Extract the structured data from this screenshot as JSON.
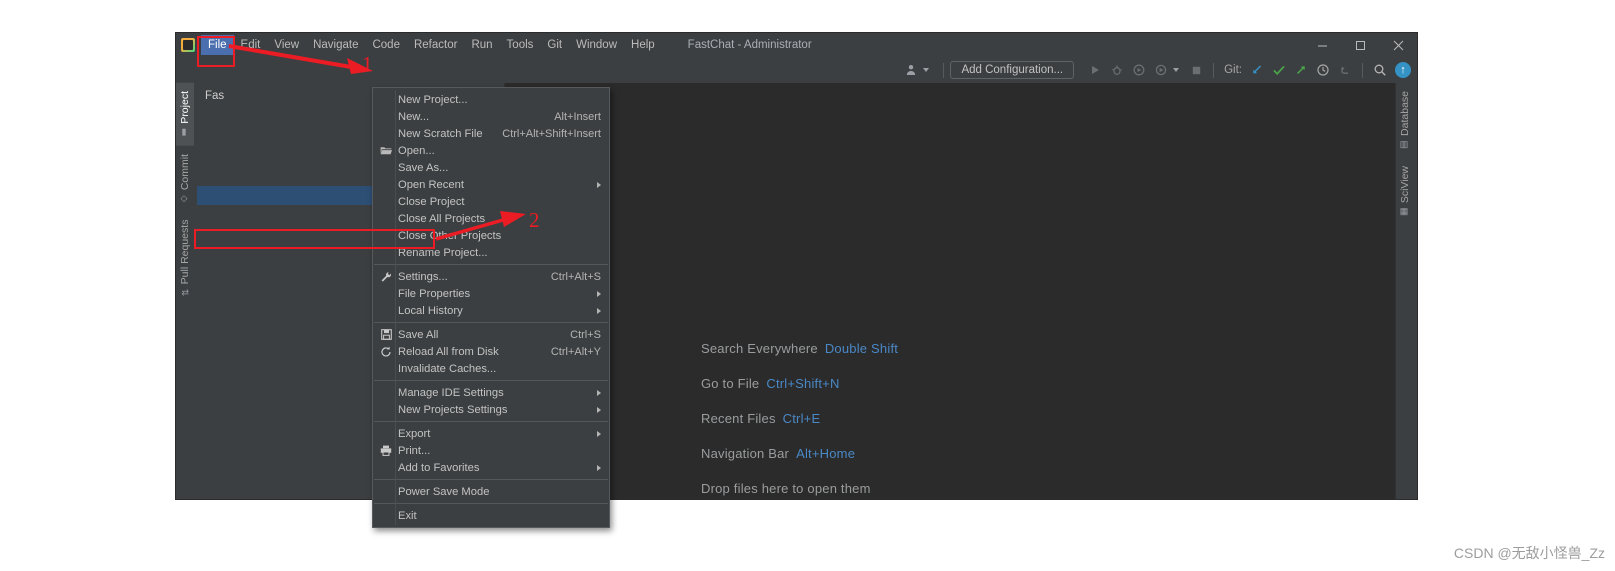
{
  "window": {
    "title": "FastChat - Administrator",
    "app_icon": "pycharm-logo-icon",
    "controls": {
      "minimize": "−",
      "maximize": "□",
      "close": "✕"
    }
  },
  "menubar": {
    "items": [
      {
        "label": "File",
        "mnemonic": "F",
        "active": true
      },
      {
        "label": "Edit",
        "mnemonic": "E",
        "active": false
      },
      {
        "label": "View",
        "mnemonic": "V",
        "active": false
      },
      {
        "label": "Navigate",
        "mnemonic": "N",
        "active": false
      },
      {
        "label": "Code",
        "mnemonic": "C",
        "active": false
      },
      {
        "label": "Refactor",
        "mnemonic": "R",
        "active": false
      },
      {
        "label": "Run",
        "mnemonic": "u",
        "active": false
      },
      {
        "label": "Tools",
        "mnemonic": "T",
        "active": false
      },
      {
        "label": "Git",
        "mnemonic": "G",
        "active": false
      },
      {
        "label": "Window",
        "mnemonic": "W",
        "active": false
      },
      {
        "label": "Help",
        "mnemonic": "H",
        "active": false
      }
    ]
  },
  "toolbar": {
    "add_configuration_label": "Add Configuration...",
    "git_label": "Git:",
    "icons": [
      "user-avatar-icon",
      "run-icon",
      "debug-icon",
      "run-coverage-icon",
      "profile-icon",
      "stop-icon",
      "git-update-icon",
      "git-commit-icon",
      "git-push-icon",
      "history-icon",
      "rollback-icon",
      "search-icon",
      "ide-update-badge"
    ],
    "update_badge": "↑"
  },
  "file_menu": {
    "items": [
      {
        "label": "New Project...",
        "mnemonic": "",
        "shortcut": "",
        "icon": "",
        "submenu": false
      },
      {
        "label": "New...",
        "mnemonic": "N",
        "shortcut": "Alt+Insert",
        "icon": "",
        "submenu": false
      },
      {
        "label": "New Scratch File",
        "mnemonic": "",
        "shortcut": "Ctrl+Alt+Shift+Insert",
        "icon": "",
        "submenu": false
      },
      {
        "label": "Open...",
        "mnemonic": "O",
        "shortcut": "",
        "icon": "folder-open-icon",
        "submenu": false
      },
      {
        "label": "Save As...",
        "mnemonic": "",
        "shortcut": "",
        "icon": "",
        "submenu": false
      },
      {
        "label": "Open Recent",
        "mnemonic": "R",
        "shortcut": "",
        "icon": "",
        "submenu": true
      },
      {
        "label": "Close Project",
        "mnemonic": "",
        "shortcut": "",
        "icon": "",
        "submenu": false
      },
      {
        "label": "Close All Projects",
        "mnemonic": "",
        "shortcut": "",
        "icon": "",
        "submenu": false
      },
      {
        "label": "Close Other Projects",
        "mnemonic": "",
        "shortcut": "",
        "icon": "",
        "submenu": false
      },
      {
        "label": "Rename Project...",
        "mnemonic": "",
        "shortcut": "",
        "icon": "",
        "submenu": false
      },
      {
        "separator": true
      },
      {
        "label": "Settings...",
        "mnemonic": "t",
        "shortcut": "Ctrl+Alt+S",
        "icon": "wrench-icon",
        "submenu": false,
        "highlighted": true
      },
      {
        "label": "File Properties",
        "mnemonic": "",
        "shortcut": "",
        "icon": "",
        "submenu": true
      },
      {
        "label": "Local History",
        "mnemonic": "H",
        "shortcut": "",
        "icon": "",
        "submenu": true
      },
      {
        "separator": true
      },
      {
        "label": "Save All",
        "mnemonic": "S",
        "shortcut": "Ctrl+S",
        "icon": "save-icon",
        "submenu": false
      },
      {
        "label": "Reload All from Disk",
        "mnemonic": "",
        "shortcut": "Ctrl+Alt+Y",
        "icon": "reload-icon",
        "submenu": false
      },
      {
        "label": "Invalidate Caches...",
        "mnemonic": "",
        "shortcut": "",
        "icon": "",
        "submenu": false
      },
      {
        "separator": true
      },
      {
        "label": "Manage IDE Settings",
        "mnemonic": "",
        "shortcut": "",
        "icon": "",
        "submenu": true
      },
      {
        "label": "New Projects Settings",
        "mnemonic": "",
        "shortcut": "",
        "icon": "",
        "submenu": true
      },
      {
        "separator": true
      },
      {
        "label": "Export",
        "mnemonic": "",
        "shortcut": "",
        "icon": "",
        "submenu": true
      },
      {
        "label": "Print...",
        "mnemonic": "P",
        "shortcut": "",
        "icon": "print-icon",
        "submenu": false
      },
      {
        "label": "Add to Favorites",
        "mnemonic": "v",
        "shortcut": "",
        "icon": "",
        "submenu": true
      },
      {
        "separator": true
      },
      {
        "label": "Power Save Mode",
        "mnemonic": "",
        "shortcut": "",
        "icon": "",
        "submenu": false
      },
      {
        "separator": true
      },
      {
        "label": "Exit",
        "mnemonic": "x",
        "shortcut": "",
        "icon": "",
        "submenu": false
      }
    ]
  },
  "left_strip": {
    "items": [
      {
        "label": "Project",
        "icon": "project-folder-icon",
        "selected": true
      },
      {
        "label": "Commit",
        "icon": "commit-icon",
        "selected": false
      },
      {
        "label": "Pull Requests",
        "icon": "pull-request-icon",
        "selected": false
      }
    ]
  },
  "right_strip": {
    "items": [
      {
        "label": "Database",
        "icon": "database-icon"
      },
      {
        "label": "SciView",
        "icon": "sciview-grid-icon"
      }
    ]
  },
  "project_panel": {
    "title": "Fas",
    "tools": [
      "collapse-all-icon",
      "settings-gear-icon",
      "hide-panel-icon"
    ]
  },
  "editor": {
    "hints": [
      {
        "label": "Search Everywhere",
        "key": "Double Shift"
      },
      {
        "label": "Go to File",
        "key": "Ctrl+Shift+N"
      },
      {
        "label": "Recent Files",
        "key": "Ctrl+E"
      },
      {
        "label": "Navigation Bar",
        "key": "Alt+Home"
      },
      {
        "label": "Drop files here to open them",
        "key": ""
      }
    ]
  },
  "annotations": {
    "step_1": "1",
    "step_2": "2",
    "accent_color": "#ec1c24"
  },
  "watermark": "CSDN @无敌小怪兽_Zz"
}
